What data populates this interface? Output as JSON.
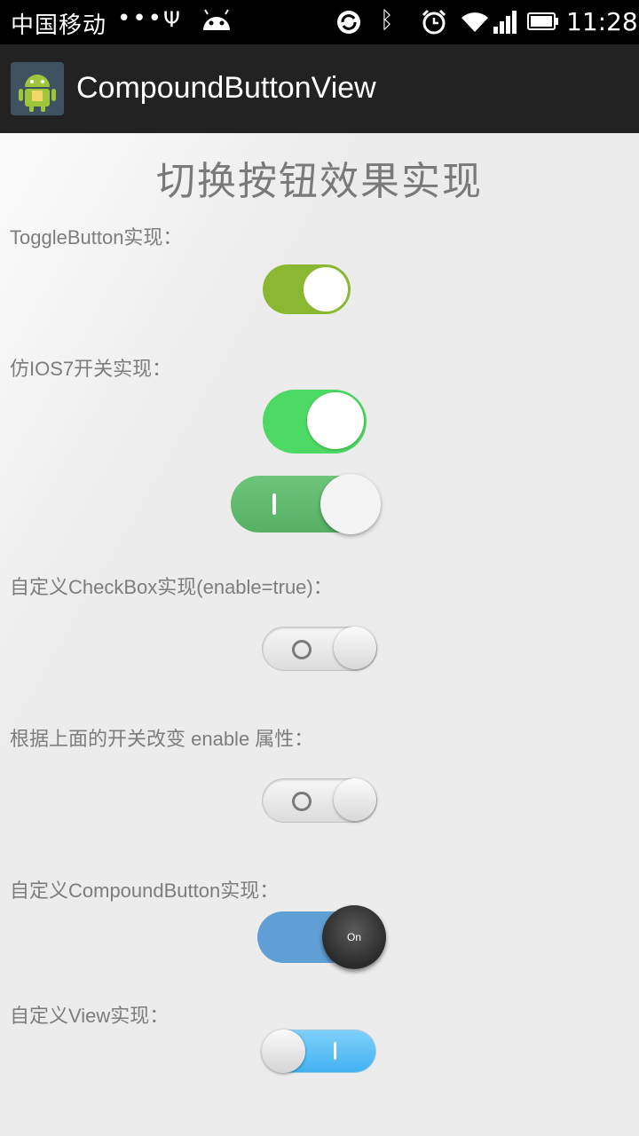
{
  "status_bar": {
    "carrier": "中国移动",
    "dots": "•••",
    "time": "11:28",
    "icons": [
      "usb-icon",
      "android-notification-icon",
      "sync-icon",
      "bluetooth-icon",
      "alarm-icon",
      "wifi-icon",
      "signal-icon",
      "battery-icon"
    ]
  },
  "action_bar": {
    "title": "CompoundButtonView",
    "app_icon": "android-app-icon"
  },
  "page": {
    "title": "切换按钮效果实现"
  },
  "sections": {
    "toggle_button": {
      "label": "ToggleButton实现：",
      "state": "on"
    },
    "ios7": {
      "label": "仿IOS7开关实现：",
      "switch_a_state": "on",
      "switch_b_state": "on"
    },
    "custom_checkbox": {
      "label": "自定义CheckBox实现(enable=true)：",
      "state": "off"
    },
    "enable_toggle": {
      "label": "根据上面的开关改变   enable 属性：",
      "state": "off"
    },
    "compound_button": {
      "label": "自定义CompoundButton实现：",
      "knob_text": "On",
      "state": "on"
    },
    "custom_view": {
      "label": "自定义View实现：",
      "state": "on"
    }
  },
  "colors": {
    "toggle_green": "#8bb833",
    "ios_green": "#4cd964",
    "compound_blue": "#5f9fd6",
    "view_blue": "#43b2f2"
  }
}
